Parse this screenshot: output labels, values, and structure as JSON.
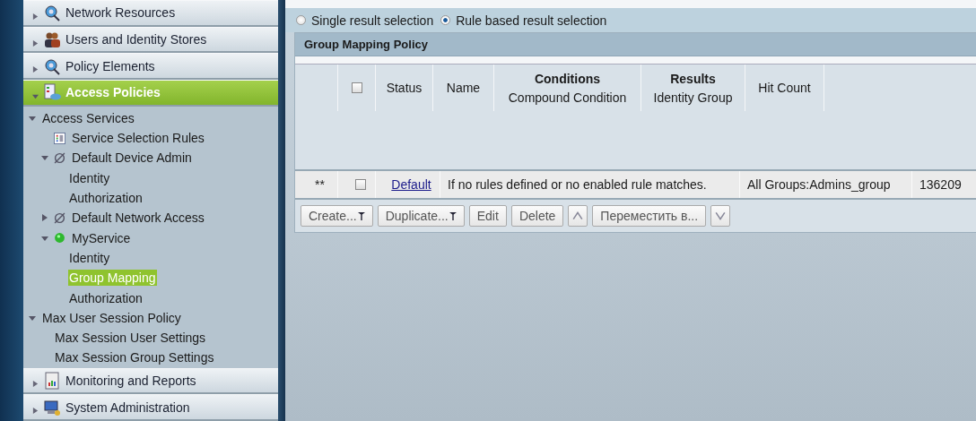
{
  "nav_sections_top": [
    {
      "label": "Network Resources",
      "kind": "network",
      "selected": false,
      "expanded": false
    },
    {
      "label": "Users and Identity Stores",
      "kind": "users",
      "selected": false,
      "expanded": false
    },
    {
      "label": "Policy Elements",
      "kind": "policy",
      "selected": false,
      "expanded": false
    },
    {
      "label": "Access Policies",
      "kind": "access",
      "selected": true,
      "expanded": true
    }
  ],
  "tree": [
    {
      "label": "Access Services",
      "expanded": true,
      "selected": false,
      "children": [
        {
          "label": "Service Selection Rules",
          "kind": "rules",
          "selected": false
        },
        {
          "label": "Default Device Admin",
          "kind": "disabled",
          "expanded": true,
          "selected": false,
          "children": [
            {
              "label": "Identity",
              "selected": false
            },
            {
              "label": "Authorization",
              "selected": false
            }
          ]
        },
        {
          "label": "Default Network Access",
          "kind": "disabled",
          "expanded": false,
          "selected": false
        },
        {
          "label": "MyService",
          "kind": "enabled",
          "expanded": true,
          "selected": false,
          "children": [
            {
              "label": "Identity",
              "selected": false
            },
            {
              "label": "Group Mapping",
              "selected": true
            },
            {
              "label": "Authorization",
              "selected": false
            }
          ]
        }
      ]
    },
    {
      "label": "Max User Session Policy",
      "expanded": true,
      "selected": false,
      "children": [
        {
          "label": "Max Session User Settings",
          "selected": false
        },
        {
          "label": "Max Session Group Settings",
          "selected": false
        }
      ]
    }
  ],
  "nav_sections_bottom": [
    {
      "label": "Monitoring and Reports",
      "kind": "report",
      "selected": false,
      "expanded": false
    },
    {
      "label": "System Administration",
      "kind": "admin",
      "selected": false,
      "expanded": false
    }
  ],
  "radios": [
    {
      "label": "Single result selection",
      "selected": false
    },
    {
      "label": "Rule based result selection",
      "selected": true
    }
  ],
  "panel": {
    "title": "Group Mapping Policy",
    "columns": [
      {
        "kind": "blank"
      },
      {
        "kind": "checkbox",
        "checked": false
      },
      {
        "kind": "text",
        "label": "Status"
      },
      {
        "kind": "text",
        "label": "Name"
      },
      {
        "kind": "group",
        "group": "Conditions",
        "label": "Compound Condition"
      },
      {
        "kind": "group",
        "group": "Results",
        "label": "Identity Group"
      },
      {
        "kind": "text",
        "label": "Hit Count"
      }
    ],
    "default_row": {
      "marker": "**",
      "checked": false,
      "name": "Default",
      "condition": "If no rules defined or no enabled rule matches.",
      "result": "All Groups:Admins_group",
      "hit_count": "136209"
    },
    "buttons": [
      {
        "kind": "menu",
        "label": "Create..."
      },
      {
        "kind": "menu",
        "label": "Duplicate..."
      },
      {
        "kind": "plain",
        "label": "Edit"
      },
      {
        "kind": "plain",
        "label": "Delete"
      },
      {
        "kind": "up"
      },
      {
        "kind": "plain",
        "label": "Переместить в..."
      },
      {
        "kind": "down"
      }
    ]
  }
}
